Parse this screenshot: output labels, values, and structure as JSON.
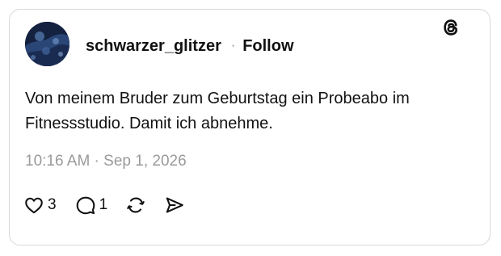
{
  "post": {
    "username": "schwarzer_glitzer",
    "separator": "·",
    "follow_label": "Follow",
    "text": "Von meinem Bruder zum Geburtstag ein Probeabo im Fitnessstudio. Damit ich abnehme.",
    "timestamp": "10:16 AM · Sep 1, 2026",
    "icons": {
      "brand": "threads-logo-icon",
      "like": "heart-icon",
      "reply": "comment-icon",
      "repost": "repost-icon",
      "share": "send-icon"
    },
    "stats": {
      "likes": "3",
      "replies": "1"
    }
  }
}
